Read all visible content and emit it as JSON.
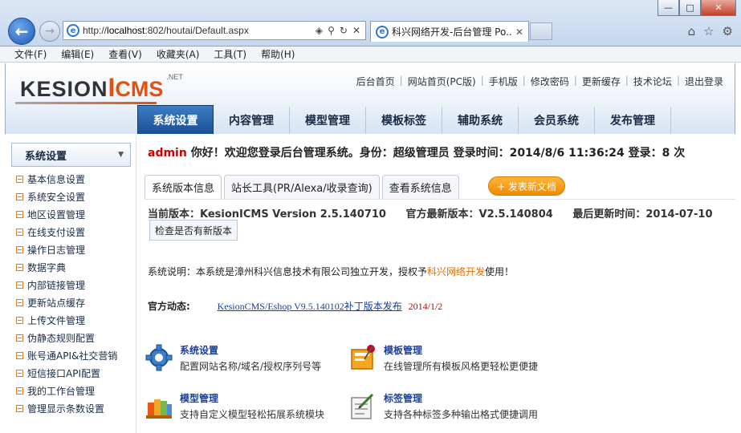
{
  "browser": {
    "address": {
      "prefix": "http://",
      "host": "localhost",
      "path": ":802/houtai/Default.aspx"
    },
    "tab_title": "科兴网络开发-后台管理 Po...",
    "window_buttons": {
      "min": "—",
      "max": "□",
      "close": "✕"
    },
    "menu": [
      "文件(F)",
      "编辑(E)",
      "查看(V)",
      "收藏夹(A)",
      "工具(T)",
      "帮助(H)"
    ]
  },
  "logo": {
    "k": "KESION",
    "i": "I",
    "cms": "CMS",
    "net": ".NET"
  },
  "top_links": [
    "后台首页",
    "网站首页(PC版)",
    "手机版",
    "修改密码",
    "更新缓存",
    "技术论坛",
    "退出登录"
  ],
  "main_nav": [
    "系统设置",
    "内容管理",
    "模型管理",
    "模板标签",
    "辅助系统",
    "会员系统",
    "发布管理"
  ],
  "sidebar": {
    "title": "系统设置",
    "items": [
      "基本信息设置",
      "系统安全设置",
      "地区设置管理",
      "在线支付设置",
      "操作日志管理",
      "数据字典",
      "内部链接管理",
      "更新站点缓存",
      "上传文件管理",
      "伪静态规则配置",
      "账号通API&社交营销",
      "短信接口API配置",
      "我的工作台管理",
      "管理显示条数设置"
    ]
  },
  "welcome": {
    "user": "admin",
    "text": " 你好！欢迎您登录后台管理系统。身份：超级管理员 登录时间：2014/8/6 11:36:24 登录：8 次"
  },
  "tabs": [
    "系统版本信息",
    "站长工具(PR/Alexa/收录查询)",
    "查看系统信息"
  ],
  "post_button": "+ 发表新文档",
  "version": {
    "current": "当前版本：KesionICMS Version 2.5.140710",
    "latest": "官方最新版本：V2.5.140804",
    "updated": "最后更新时间：2014-07-10"
  },
  "check_button": "检查是否有新版本",
  "sys_note": {
    "prefix": "系统说明：本系统是漳州科兴信息技术有限公司独立开发，授权予",
    "brand": "科兴网络开发",
    "suffix": "使用！"
  },
  "news": {
    "label": "官方动态:",
    "link": "KesionCMS/Eshop V9.5.140102补丁版本发布",
    "date": "2014/1/2"
  },
  "quick_links": [
    {
      "title": "系统设置",
      "desc": "配置网站名称/域名/授权序列号等",
      "icon": "gear-icon"
    },
    {
      "title": "模板管理",
      "desc": "在线管理所有模板风格更轻松更便捷",
      "icon": "template-icon"
    },
    {
      "title": "模型管理",
      "desc": "支持自定义模型轻松拓展系统模块",
      "icon": "books-icon"
    },
    {
      "title": "标签管理",
      "desc": "支持各种标签多种输出格式便捷调用",
      "icon": "label-edit-icon"
    }
  ]
}
